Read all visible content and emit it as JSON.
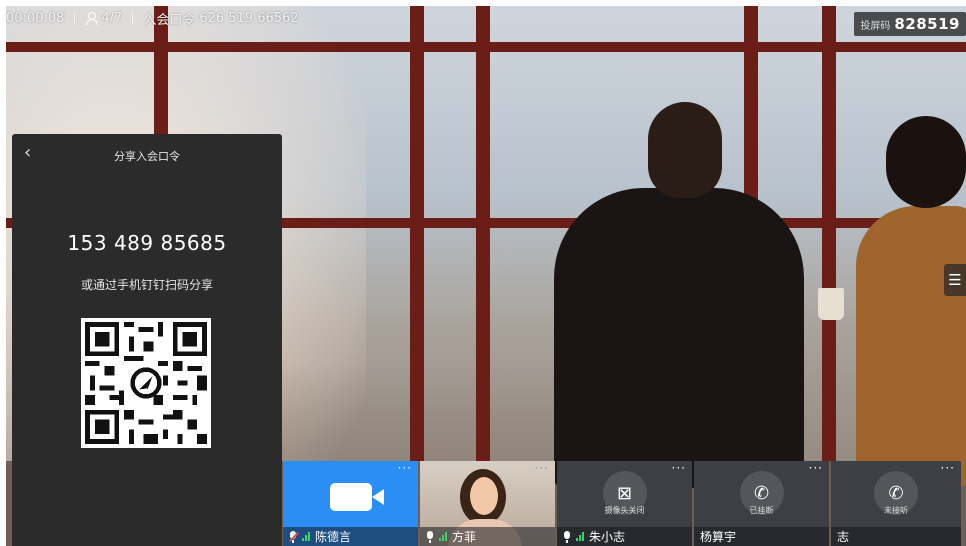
{
  "topbar": {
    "timer": "00:00:08",
    "participants": "4/7",
    "meeting_code_label": "入会口令",
    "meeting_code": "626 519 66562"
  },
  "screen_code": {
    "label": "投屏码",
    "value": "828519"
  },
  "share_panel": {
    "title": "分享入会口令",
    "code": "153 489 85685",
    "hint": "或通过手机钉钉扫码分享"
  },
  "participants": [
    {
      "name": "陈德言",
      "state": "",
      "active": true
    },
    {
      "name": "方菲",
      "state": ""
    },
    {
      "name": "朱小志",
      "state": "摄像头关闭"
    },
    {
      "name": "杨算宇",
      "state": "已挂断"
    },
    {
      "name": "志",
      "state": "未接听"
    }
  ],
  "icons": {
    "back": "chevron-left-icon",
    "menu": "menu-icon",
    "more": "more-dots-icon",
    "camera": "camera-icon",
    "camera_off": "camera-off-icon",
    "phone": "phone-icon",
    "mic": "mic-icon",
    "signal": "signal-icon"
  },
  "colors": {
    "active_tile": "#2b8ef5",
    "signal": "#38d36b",
    "panel": "#2b2b2b",
    "tile": "#3c3f44"
  }
}
